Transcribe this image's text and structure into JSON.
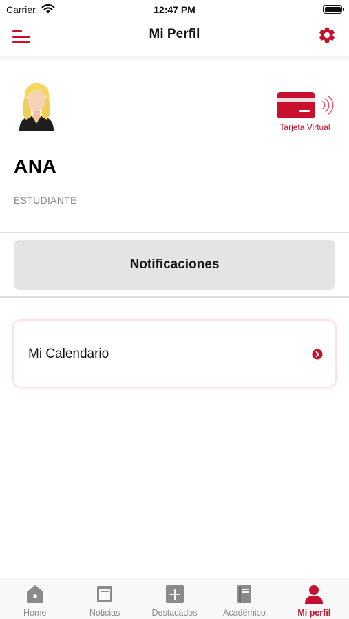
{
  "status_bar": {
    "carrier": "Carrier",
    "time": "12:47 PM"
  },
  "nav": {
    "title": "Mi Perfil",
    "menu_icon": "hamburger-menu-icon",
    "settings_icon": "gear-icon"
  },
  "profile": {
    "name": "ANA",
    "role": "ESTUDIANTE",
    "virtual_card_label": "Tarjeta Virtual"
  },
  "notifications_label": "Notificaciones",
  "calendar_label": "Mi Calendario",
  "tabs": [
    {
      "label": "Home",
      "icon": "home-icon",
      "active": false
    },
    {
      "label": "Noticias",
      "icon": "news-icon",
      "active": false
    },
    {
      "label": "Destacados",
      "icon": "plus-icon",
      "active": false
    },
    {
      "label": "Académico",
      "icon": "book-icon",
      "active": false
    },
    {
      "label": "Mi perfil",
      "icon": "person-icon",
      "active": true
    }
  ],
  "colors": {
    "accent": "#c8102e",
    "inactive": "#8a8a8a",
    "button_bg": "#e4e4e6"
  }
}
